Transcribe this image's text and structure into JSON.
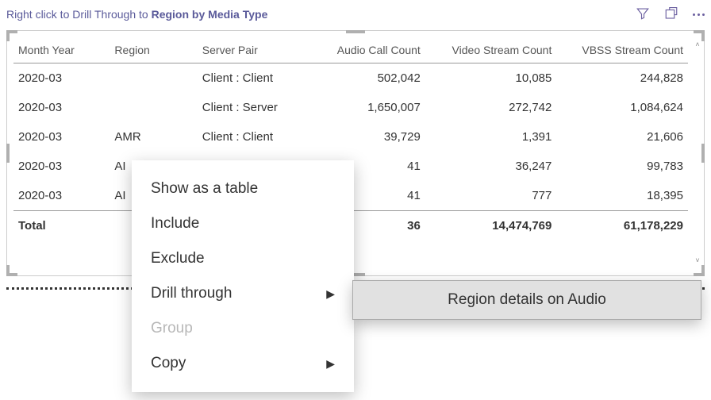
{
  "hint": {
    "prefix": "Right click to Drill Through to ",
    "bold": "Region by Media Type"
  },
  "columns": {
    "month": "Month Year",
    "region": "Region",
    "server": "Server Pair",
    "audio": "Audio Call Count",
    "video": "Video Stream Count",
    "vbss": "VBSS Stream Count"
  },
  "rows": [
    {
      "month": "2020-03",
      "region": "",
      "server": "Client : Client",
      "audio": "502,042",
      "video": "10,085",
      "vbss": "244,828"
    },
    {
      "month": "2020-03",
      "region": "",
      "server": "Client : Server",
      "audio": "1,650,007",
      "video": "272,742",
      "vbss": "1,084,624"
    },
    {
      "month": "2020-03",
      "region": "AMR",
      "server": "Client : Client",
      "audio": "39,729",
      "video": "1,391",
      "vbss": "21,606"
    },
    {
      "month": "2020-03",
      "region": "AI",
      "server": "",
      "audio": "41",
      "video": "36,247",
      "vbss": "99,783"
    },
    {
      "month": "2020-03",
      "region": "AI",
      "server": "",
      "audio": "41",
      "video": "777",
      "vbss": "18,395"
    }
  ],
  "total": {
    "label": "Total",
    "audio": "36",
    "video": "14,474,769",
    "vbss": "61,178,229"
  },
  "menu": {
    "show_table": "Show as a table",
    "include": "Include",
    "exclude": "Exclude",
    "drill": "Drill through",
    "group": "Group",
    "copy": "Copy"
  },
  "submenu": {
    "item1": "Region details on Audio"
  },
  "chart_data": {
    "type": "table",
    "title": "Right click to Drill Through to Region by Media Type",
    "columns": [
      "Month Year",
      "Region",
      "Server Pair",
      "Audio Call Count",
      "Video Stream Count",
      "VBSS Stream Count"
    ],
    "rows": [
      [
        "2020-03",
        "",
        "Client : Client",
        502042,
        10085,
        244828
      ],
      [
        "2020-03",
        "",
        "Client : Server",
        1650007,
        272742,
        1084624
      ],
      [
        "2020-03",
        "AMR",
        "Client : Client",
        39729,
        1391,
        21606
      ],
      [
        "2020-03",
        "AI",
        "",
        41,
        36247,
        99783
      ],
      [
        "2020-03",
        "AI",
        "",
        41,
        777,
        18395
      ]
    ],
    "total": {
      "Audio Call Count": 36,
      "Video Stream Count": 14474769,
      "VBSS Stream Count": 61178229
    }
  }
}
